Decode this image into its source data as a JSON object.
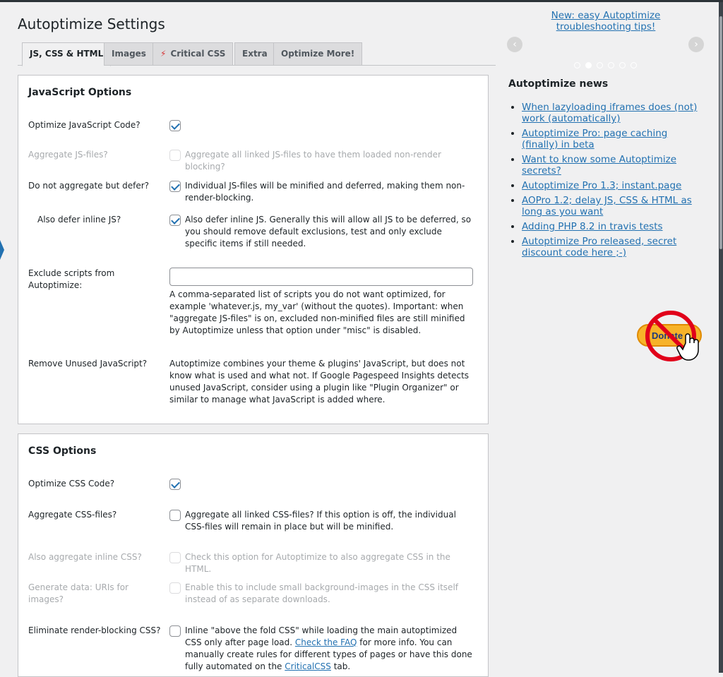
{
  "page_title": "Autoptimize Settings",
  "tabs": [
    "JS, CSS & HTML",
    "Images",
    "Critical CSS",
    "Extra",
    "Optimize More!"
  ],
  "js_section": {
    "heading": "JavaScript Options",
    "rows": [
      {
        "label": "Optimize JavaScript Code?",
        "checked": true,
        "desc": ""
      },
      {
        "label": "Aggregate JS-files?",
        "checked": false,
        "desc": "Aggregate all linked JS-files to have them loaded non-render blocking?"
      },
      {
        "label": "Do not aggregate but defer?",
        "checked": true,
        "desc": "Individual JS-files will be minified and deferred, making them non-render-blocking."
      },
      {
        "label": "Also defer inline JS?",
        "checked": true,
        "desc": "Also defer inline JS. Generally this will allow all JS to be deferred, so you should remove default exclusions, test and only exclude specific items if still needed."
      }
    ],
    "exclude_label": "Exclude scripts from Autoptimize:",
    "exclude_value": "",
    "exclude_desc": "A comma-separated list of scripts you do not want optimized, for example 'whatever.js, my_var' (without the quotes). Important: when \"aggregate JS-files\" is on, excluded non-minified files are still minified by Autoptimize unless that option under \"misc\" is disabled.",
    "unused_label": "Remove Unused JavaScript?",
    "unused_desc": "Autoptimize combines your theme & plugins' JavaScript, but does not know what is used and what not. If Google Pagespeed Insights detects unused JavaScript, consider using a plugin like \"Plugin Organizer\" or similar to manage what JavaScript is added where."
  },
  "css_section": {
    "heading": "CSS Options",
    "rows": [
      {
        "label": "Optimize CSS Code?",
        "checked": true,
        "desc": ""
      },
      {
        "label": "Aggregate CSS-files?",
        "checked": false,
        "desc": "Aggregate all linked CSS-files? If this option is off, the individual CSS-files will remain in place but will be minified."
      },
      {
        "label": "Also aggregate inline CSS?",
        "checked": false,
        "desc": "Check this option for Autoptimize to also aggregate CSS in the HTML."
      },
      {
        "label": "Generate data: URIs for images?",
        "checked": false,
        "desc": "Enable this to include small background-images in the CSS itself instead of as separate downloads."
      }
    ],
    "render_label": "Eliminate render-blocking CSS?",
    "render_desc_1": "Inline \"above the fold CSS\" while loading the main autoptimized CSS only after page load.",
    "render_link_faq": "Check the FAQ",
    "render_desc_2": "for more info. You can manually create rules for different types of pages or have this done fully automated on the",
    "render_link_tab": "CriticalCSS",
    "render_desc_3": "tab."
  },
  "sidebar": {
    "tip_link": "New: easy Autoptimize troubleshooting tips!",
    "news_title": "Autoptimize news",
    "news": [
      "When lazyloading iframes does (not) work (automatically)",
      "Autoptimize Pro: page caching (finally) in beta",
      "Want to know some Autoptimize secrets?",
      "Autoptimize Pro 1.3; instant.page",
      "AOPro 1.2; delay JS, CSS & HTML as long as you want",
      "Adding PHP 8.2 in travis tests",
      "Autoptimize Pro released, secret discount code here ;-)"
    ],
    "donate_text": "Donate"
  },
  "colors": {
    "link": "#2271b1",
    "accent": "#2271b1",
    "background": "#f0f0f1"
  }
}
